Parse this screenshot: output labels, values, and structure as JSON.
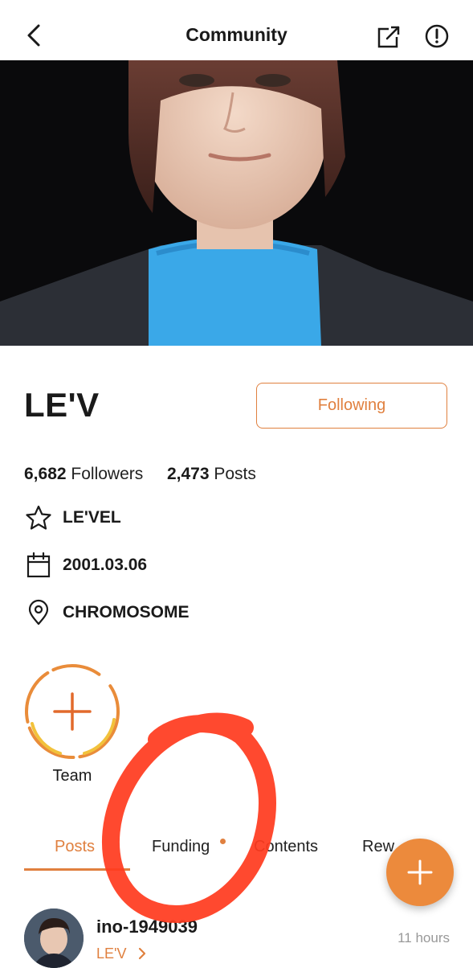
{
  "header": {
    "title": "Community"
  },
  "profile": {
    "name": "LE'V",
    "follow_label": "Following",
    "followers_count": "6,682",
    "followers_label": "Followers",
    "posts_count": "2,473",
    "posts_label": "Posts",
    "fandom": "LE'VEL",
    "birthday": "2001.03.06",
    "location": "CHROMOSOME"
  },
  "team": {
    "label": "Team"
  },
  "tabs": [
    {
      "label": "Posts",
      "active": true
    },
    {
      "label": "Funding",
      "active": false
    },
    {
      "label": "Contents",
      "active": false
    },
    {
      "label": "Rew",
      "active": false
    }
  ],
  "post": {
    "username": "ino-1949039",
    "link_label": "LE'V",
    "time": "11 hours"
  },
  "colors": {
    "accent": "#e0803f",
    "fab": "#ec8a3c",
    "annotation": "#ff3b1f"
  },
  "icons": [
    "back-arrow-icon",
    "share-icon",
    "info-icon",
    "star-icon",
    "calendar-icon",
    "location-pin-icon",
    "plus-icon",
    "chevron-right-icon"
  ]
}
